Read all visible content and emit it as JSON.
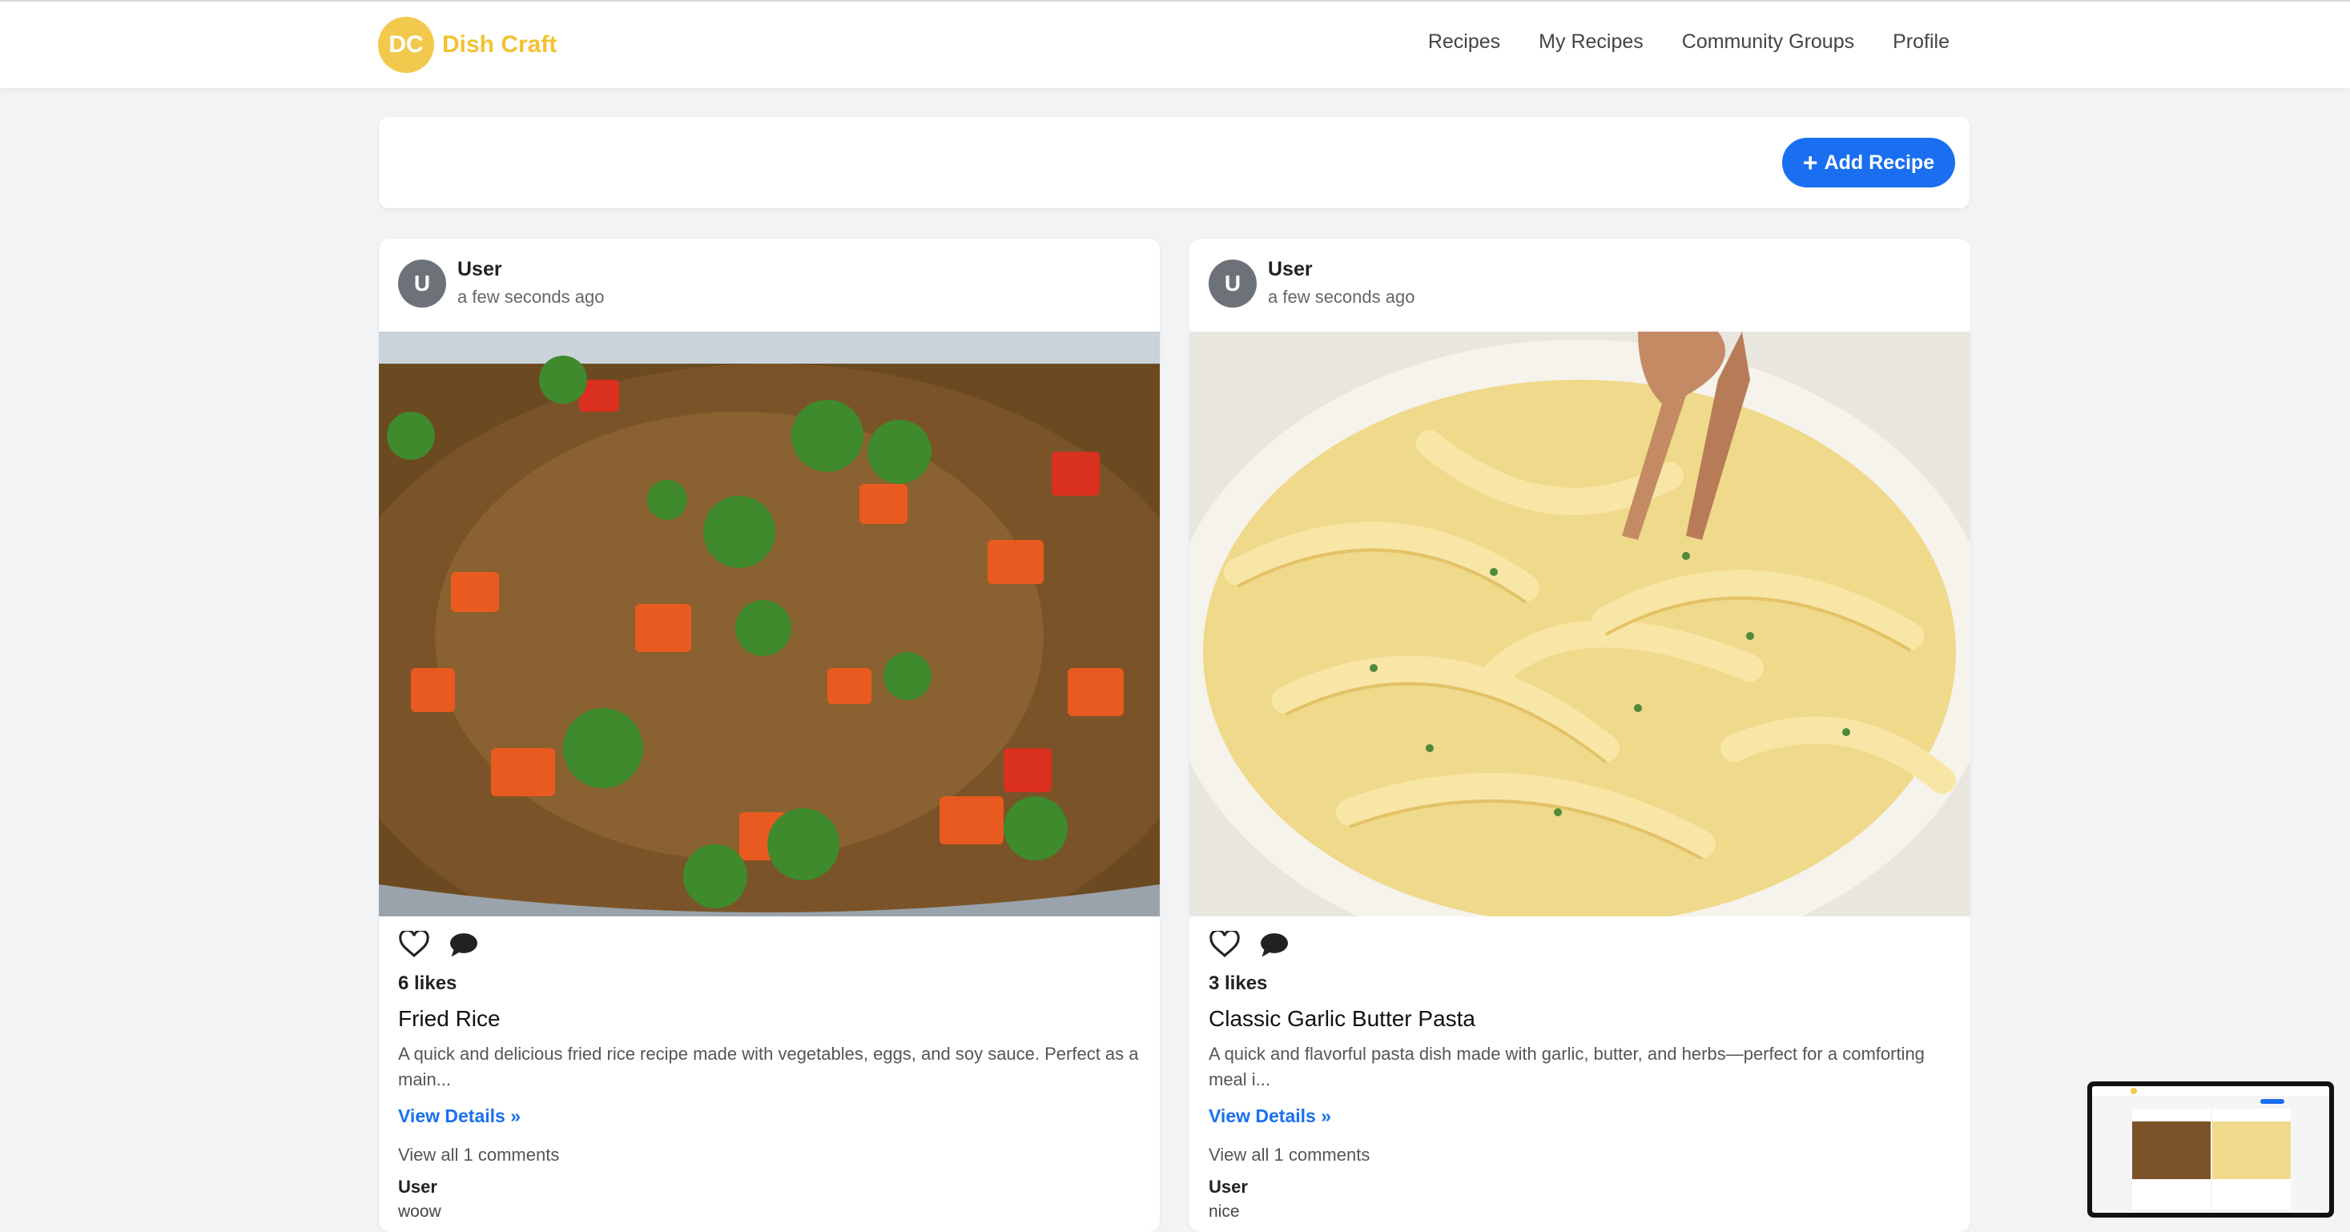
{
  "brand": {
    "badge": "DC",
    "name": "Dish Craft"
  },
  "nav": {
    "items": [
      "Recipes",
      "My Recipes",
      "Community Groups",
      "Profile"
    ]
  },
  "toolbar": {
    "add_label": "Add Recipe"
  },
  "posts": [
    {
      "avatar": "U",
      "author": "User",
      "time": "a few seconds ago",
      "likes": "6 likes",
      "title": "Fried Rice",
      "description": "A quick and delicious fried rice recipe made with vegetables, eggs, and soy sauce. Perfect as a main...",
      "details": "View Details »",
      "view_all": "View all 1 comments",
      "comment_author": "User",
      "comment_text": "woow",
      "image": "fried-rice-photo"
    },
    {
      "avatar": "U",
      "author": "User",
      "time": "a few seconds ago",
      "likes": "3 likes",
      "title": "Classic Garlic Butter Pasta",
      "description": "A quick and flavorful pasta dish made with garlic, butter, and herbs—perfect for a comforting meal i...",
      "details": "View Details »",
      "view_all": "View all 1 comments",
      "comment_author": "User",
      "comment_text": "nice",
      "image": "pasta-photo"
    }
  ],
  "colors": {
    "brand": "#f2c230",
    "accent": "#1a6ff0",
    "background": "#f2f3f5"
  },
  "icons": [
    "heart-icon",
    "comment-icon",
    "plus-icon"
  ]
}
